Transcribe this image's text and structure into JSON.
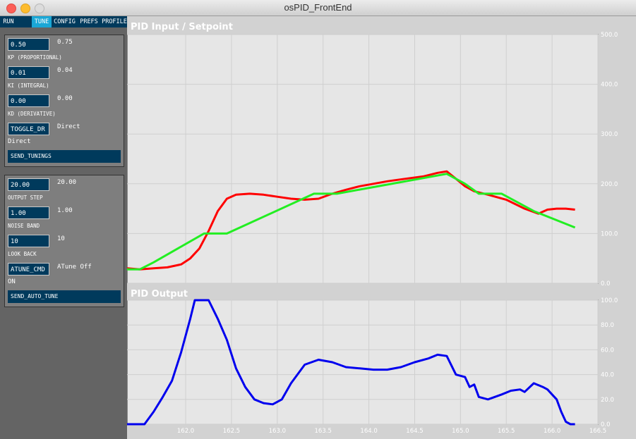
{
  "window": {
    "title": "osPID_FrontEnd"
  },
  "tabs": [
    {
      "label": "RUN",
      "active": false
    },
    {
      "label": "TUNE",
      "active": true
    },
    {
      "label": "CONFIG",
      "active": false
    },
    {
      "label": "PREFS",
      "active": false
    },
    {
      "label": "PROFILE",
      "active": false
    }
  ],
  "tune": {
    "kp": {
      "value": "0.50",
      "current": "0.75",
      "label": "KP (PROPORTIONAL)"
    },
    "ki": {
      "value": "0.01",
      "current": "0.04",
      "label": "KI (INTEGRAL)"
    },
    "kd": {
      "value": "0.00",
      "current": "0.00",
      "label": "KD (DERIVATIVE)"
    },
    "direction": {
      "button": "TOGGLE_DR",
      "current": "Direct",
      "value": "Direct"
    },
    "send_label": "SEND_TUNINGS"
  },
  "autotune": {
    "output_step": {
      "value": "20.00",
      "current": "20.00",
      "label": "OUTPUT STEP"
    },
    "noise_band": {
      "value": "1.00",
      "current": "1.00",
      "label": "NOISE BAND"
    },
    "look_back": {
      "value": "10",
      "current": "10",
      "label": "LOOK BACK"
    },
    "command": {
      "button": "ATUNE_CMD",
      "current": "ATune Off",
      "value": "ON"
    },
    "send_label": "SEND_AUTO_TUNE"
  },
  "colors": {
    "input": "#ff0000",
    "setpoint": "#22ee22",
    "output": "#0000ee",
    "plot_bg": "#e6e6e6",
    "tab_bg": "#003a5c",
    "tab_active": "#1aa7d6"
  },
  "chart_data": [
    {
      "type": "line",
      "title": "PID Input / Setpoint",
      "xlim": [
        161.36,
        166.5
      ],
      "ylim": [
        0,
        500
      ],
      "y_ticks": [
        "500.0",
        "400.0",
        "300.0",
        "200.0",
        "100.0",
        "0.0"
      ],
      "grid": true,
      "series": [
        {
          "color": "#ff0000",
          "x": [
            161.36,
            161.5,
            161.65,
            161.8,
            161.95,
            162.05,
            162.15,
            162.25,
            162.35,
            162.45,
            162.55,
            162.7,
            162.85,
            163.0,
            163.15,
            163.3,
            163.45,
            163.6,
            163.75,
            163.9,
            164.05,
            164.2,
            164.4,
            164.6,
            164.75,
            164.85,
            164.95,
            165.05,
            165.15,
            165.3,
            165.5,
            165.7,
            165.85,
            165.95,
            166.05,
            166.15,
            166.25
          ],
          "y": [
            30,
            28,
            30,
            32,
            38,
            50,
            70,
            105,
            145,
            170,
            178,
            180,
            178,
            174,
            170,
            168,
            170,
            180,
            188,
            195,
            200,
            205,
            210,
            215,
            222,
            225,
            210,
            195,
            185,
            178,
            168,
            150,
            140,
            148,
            150,
            150,
            148
          ]
        },
        {
          "color": "#22ee22",
          "x": [
            161.36,
            161.5,
            161.65,
            162.2,
            162.45,
            163.4,
            163.65,
            164.85,
            165.05,
            165.2,
            165.45,
            165.8,
            166.25
          ],
          "y": [
            28,
            28,
            42,
            100,
            100,
            180,
            180,
            220,
            200,
            180,
            180,
            145,
            112
          ]
        }
      ]
    },
    {
      "type": "line",
      "title": "PID Output",
      "xlim": [
        161.36,
        166.5
      ],
      "ylim": [
        0,
        100
      ],
      "x_ticks": [
        "162.0",
        "162.5",
        "163.0",
        "163.5",
        "164.0",
        "164.5",
        "165.0",
        "165.5",
        "166.0",
        "166.5"
      ],
      "y_ticks": [
        "100.0",
        "80.0",
        "60.0",
        "40.0",
        "20.0",
        "0.0"
      ],
      "grid": true,
      "series": [
        {
          "color": "#0000ee",
          "x": [
            161.36,
            161.55,
            161.65,
            161.75,
            161.85,
            161.95,
            162.05,
            162.1,
            162.25,
            162.35,
            162.45,
            162.55,
            162.65,
            162.75,
            162.85,
            162.95,
            163.05,
            163.15,
            163.3,
            163.45,
            163.6,
            163.75,
            163.9,
            164.05,
            164.2,
            164.35,
            164.5,
            164.65,
            164.75,
            164.85,
            164.95,
            165.05,
            165.1,
            165.15,
            165.2,
            165.3,
            165.45,
            165.55,
            165.65,
            165.7,
            165.8,
            165.9,
            165.95,
            166.0,
            166.05,
            166.1,
            166.15,
            166.2,
            166.25
          ],
          "y": [
            0,
            0,
            10,
            22,
            35,
            58,
            85,
            100,
            100,
            85,
            68,
            45,
            30,
            20,
            17,
            16,
            20,
            33,
            48,
            52,
            50,
            46,
            45,
            44,
            44,
            46,
            50,
            53,
            56,
            55,
            40,
            38,
            30,
            32,
            22,
            20,
            24,
            27,
            28,
            26,
            33,
            30,
            28,
            24,
            20,
            10,
            2,
            0,
            0
          ]
        }
      ]
    }
  ]
}
